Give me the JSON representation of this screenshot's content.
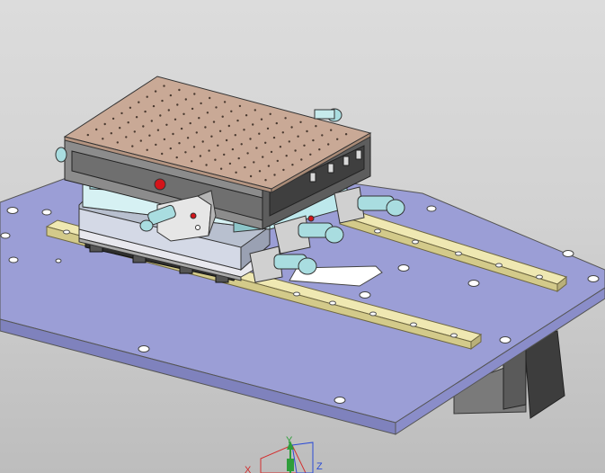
{
  "viewport": {
    "background_top": "#dcdcdc",
    "background_bottom": "#bdbdbd"
  },
  "model": {
    "name_icon": "xy-stage-assembly",
    "colors": {
      "base_plate": "#9b9ed6",
      "base_plate_edge": "#7f82bd",
      "rail": "#efe8b2",
      "rail_edge": "#b9b07a",
      "carriage": "#b8c0cf",
      "table_top": "#c9a996",
      "table_side": "#8c8c8c",
      "knob": "#a9dde0",
      "motor": "#3d3d3d",
      "red_marker": "#d4141a"
    }
  },
  "triad": {
    "axis_labels": {
      "y": "Y",
      "x": "X",
      "z": "Z"
    },
    "colors": {
      "x": "#d32f2f",
      "y": "#2e9e3a",
      "z": "#2b4bd6"
    }
  }
}
